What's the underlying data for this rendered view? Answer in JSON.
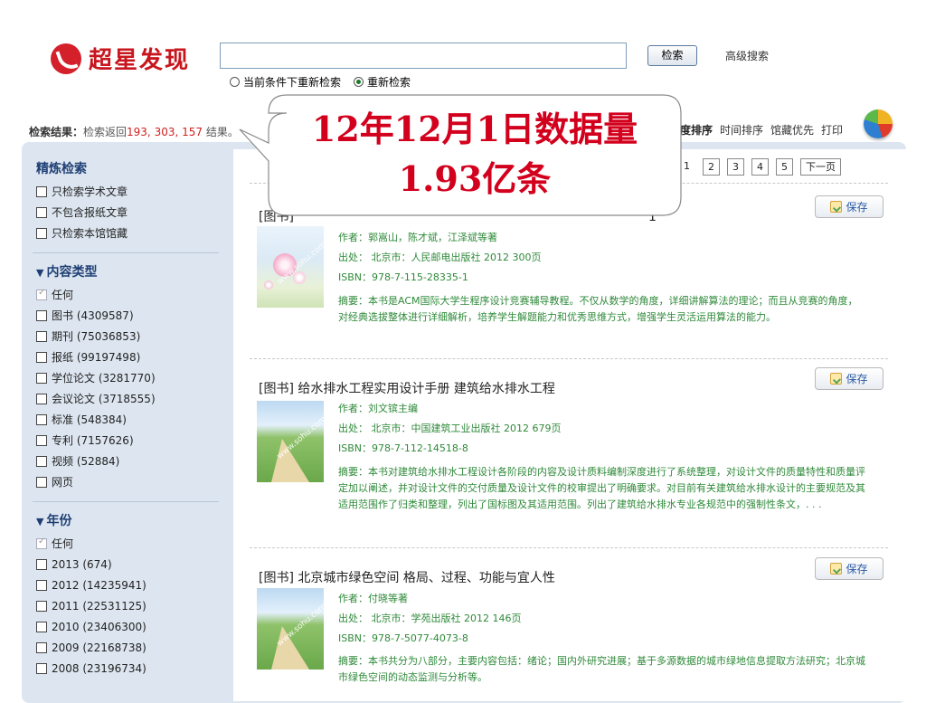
{
  "header": {
    "logo_text": "超星发现",
    "search_value": "",
    "search_button": "检索",
    "advanced_link": "高级搜索",
    "radio_options": [
      {
        "label": "当前条件下重新检索",
        "checked": false
      },
      {
        "label": "重新检索",
        "checked": true
      }
    ]
  },
  "summary": {
    "label": "检索结果：",
    "prefix": "检索返回",
    "count": "193, 303, 157",
    "suffix": " 结果。"
  },
  "sort": {
    "items": [
      "关度排序",
      "时间排序",
      "馆藏优先",
      "打印"
    ]
  },
  "pager": {
    "pages": [
      "1",
      "2",
      "3",
      "4",
      "5"
    ],
    "next": "下一页"
  },
  "sidebar": {
    "refine_heading": "精炼检索",
    "refine_items": [
      "只检索学术文章",
      "不包含报纸文章",
      "只检索本馆馆藏"
    ],
    "type_heading": "内容类型",
    "type_items": [
      "任何",
      "图书 (4309587)",
      "期刊 (75036853)",
      "报纸 (99197498)",
      "学位论文 (3281770)",
      "会议论文 (3718555)",
      "标准 (548384)",
      "专利 (7157626)",
      "视频 (52884)",
      "网页"
    ],
    "year_heading": "年份",
    "year_items": [
      "任何",
      "2013 (674)",
      "2012 (14235941)",
      "2011 (22531125)",
      "2010 (23406300)",
      "2009 (22168738)",
      "2008 (23196734)"
    ]
  },
  "results": [
    {
      "title": "[图书]",
      "title_tail": "1",
      "author": "作者：郭嵩山，陈才斌，江泽斌等著",
      "source": "出处：  北京市：人民邮电出版社   2012   300页",
      "isbn": "ISBN：978-7-115-28335-1",
      "abstract": "摘要：本书是ACM国际大学生程序设计竞赛辅导教程。不仅从数学的角度，详细讲解算法的理论；而且从竞赛的角度，对经典选拔整体进行详细解析，培养学生解题能力和优秀思维方式，增强学生灵活运用算法的能力。",
      "save": "保存"
    },
    {
      "title": "[图书] 给水排水工程实用设计手册 建筑给水排水工程",
      "author": "作者：刘文镔主编",
      "source": "出处：  北京市：中国建筑工业出版社   2012   679页",
      "isbn": "ISBN：978-7-112-14518-8",
      "abstract": "摘要：本书对建筑给水排水工程设计各阶段的内容及设计质料编制深度进行了系统整理，对设计文件的质量特性和质量评定加以阐述，并对设计文件的交付质量及设计文件的校审提出了明确要求。对目前有关建筑给水排水设计的主要规范及其适用范围作了归类和整理，列出了国标图及其适用范围。列出了建筑给水排水专业各规范中的强制性条文，. . .",
      "save": "保存"
    },
    {
      "title": "[图书] 北京城市绿色空间 格局、过程、功能与宜人性",
      "author": "作者：付晓等著",
      "source": "出处：  北京市：学苑出版社   2012   146页",
      "isbn": "ISBN：978-7-5077-4073-8",
      "abstract": "摘要：本书共分为八部分，主要内容包括：绪论；国内外研究进展；基于多源数据的城市绿地信息提取方法研究；北京城市绿色空间的动态监测与分析等。",
      "save": "保存"
    }
  ],
  "callout": {
    "line1": "12年12月1日数据量",
    "line2": "1.93亿条"
  },
  "thumb_watermark": "www.sohu.com"
}
